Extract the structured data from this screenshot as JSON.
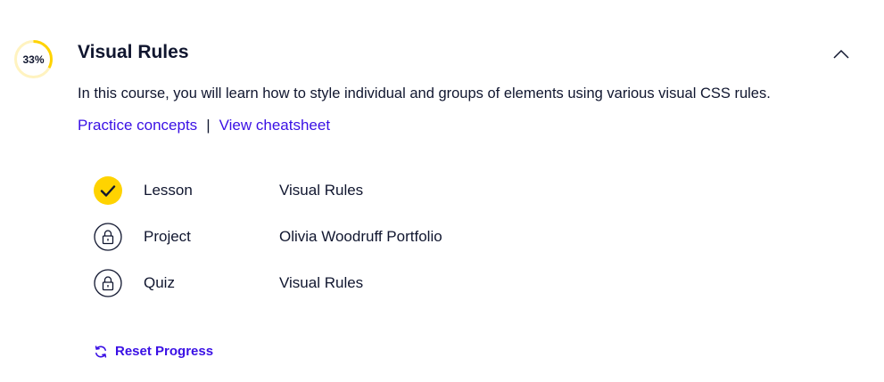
{
  "module": {
    "progress_value": 0.33,
    "progress_label": "33%",
    "title": "Visual Rules",
    "description": "In this course, you will learn how to style individual and groups of elements using various visual CSS rules.",
    "links": {
      "practice": "Practice concepts",
      "separator": "|",
      "cheatsheet": "View cheatsheet"
    },
    "items": [
      {
        "type": "Lesson",
        "name": "Visual Rules",
        "status": "completed",
        "icon": "check-icon"
      },
      {
        "type": "Project",
        "name": "Olivia Woodruff Portfolio",
        "status": "locked",
        "icon": "lock-icon"
      },
      {
        "type": "Quiz",
        "name": "Visual Rules",
        "status": "locked",
        "icon": "lock-icon"
      }
    ],
    "reset_label": "Reset Progress",
    "colors": {
      "accent": "#ffd300",
      "ring_track": "#fff3c0",
      "link": "#3a10e5",
      "text": "#10162f"
    }
  }
}
